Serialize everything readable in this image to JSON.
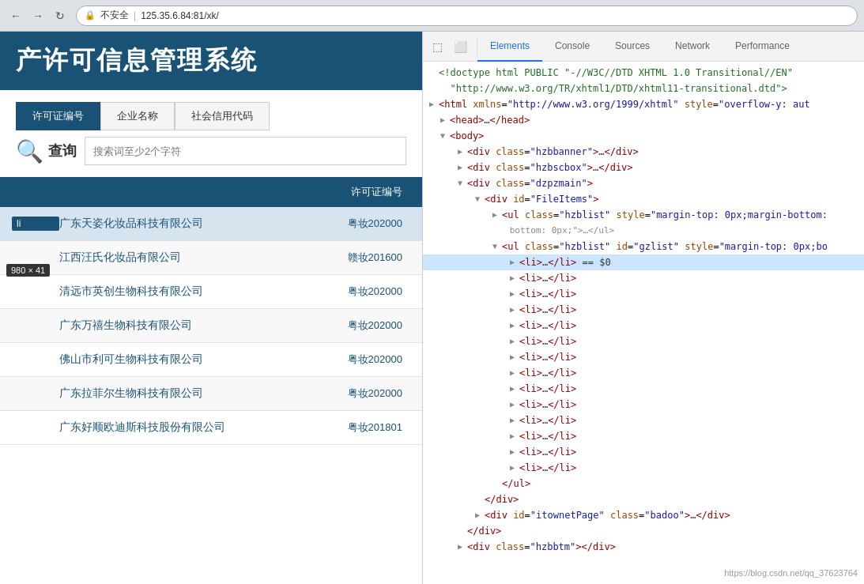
{
  "browser": {
    "back_label": "←",
    "forward_label": "→",
    "refresh_label": "↻",
    "address": "125.35.6.84:81/xk/",
    "lock_icon": "🔒",
    "insecure_label": "不安全"
  },
  "webpage": {
    "title": "产许可信息管理系统",
    "tabs": [
      {
        "label": "许可证编号",
        "active": true
      },
      {
        "label": "企业名称",
        "active": false
      },
      {
        "label": "社会信用代码",
        "active": false
      }
    ],
    "search_placeholder": "搜索词至少2个字符",
    "query_label": "查询",
    "table_header": {
      "col1": "",
      "col2": "许可证编号",
      "col3": ""
    },
    "tooltip": "980 × 41",
    "rows": [
      {
        "index": "li",
        "name": "广东天姿化妆品科技有限公司",
        "license": "粤妆202000",
        "highlighted": true
      },
      {
        "index": "",
        "name": "江西汪氏化妆品有限公司",
        "license": "赣妆201600",
        "highlighted": false
      },
      {
        "index": "",
        "name": "清远市英创生物科技有限公司",
        "license": "粤妆202000",
        "highlighted": false
      },
      {
        "index": "",
        "name": "广东万禧生物科技有限公司",
        "license": "粤妆202000",
        "highlighted": false
      },
      {
        "index": "",
        "name": "佛山市利可生物科技有限公司",
        "license": "粤妆202000",
        "highlighted": false
      },
      {
        "index": "",
        "name": "广东拉菲尔生物科技有限公司",
        "license": "粤妆202000",
        "highlighted": false
      },
      {
        "index": "",
        "name": "广东好顺欧迪斯科技股份有限公司",
        "license": "粤妆201801",
        "highlighted": false
      }
    ]
  },
  "devtools": {
    "tabs": [
      {
        "label": "Elements",
        "active": true
      },
      {
        "label": "Console",
        "active": false
      },
      {
        "label": "Sources",
        "active": false
      },
      {
        "label": "Network",
        "active": false
      },
      {
        "label": "Performance",
        "active": false
      }
    ],
    "code_lines": [
      {
        "indent": 0,
        "arrow": "none",
        "content": "<!doctype html PUBLIC \"-//W3C//DTD XHTML 1.0 Transitional//EN\"",
        "type": "comment"
      },
      {
        "indent": 0,
        "arrow": "none",
        "content": "  \"http://www.w3.org/TR/xhtml1/DTD/xhtml11-transitional.dtd\">",
        "type": "comment"
      },
      {
        "indent": 0,
        "arrow": "collapsed",
        "content": "<html xmlns=\"http://www.w3.org/1999/xhtml\" style=\"overflow-y: aut",
        "type": "tag"
      },
      {
        "indent": 1,
        "arrow": "collapsed",
        "content": "<head>…</head>",
        "type": "tag"
      },
      {
        "indent": 1,
        "arrow": "expanded",
        "content": "<body>",
        "type": "tag"
      },
      {
        "indent": 2,
        "arrow": "collapsed",
        "content": "<div class=\"hzbbanner\">…</div>",
        "type": "tag"
      },
      {
        "indent": 2,
        "arrow": "collapsed",
        "content": "<div class=\"hzbscbox\">…</div>",
        "type": "tag"
      },
      {
        "indent": 2,
        "arrow": "expanded",
        "content": "<div class=\"dzpzmain\">",
        "type": "tag"
      },
      {
        "indent": 3,
        "arrow": "expanded",
        "content": "<div id=\"FileItems\">",
        "type": "tag"
      },
      {
        "indent": 4,
        "arrow": "collapsed",
        "content": "<ul class=\"hzblist\" style=\"margin-top: 0px;margin-bottom:",
        "type": "tag"
      },
      {
        "indent": 4,
        "arrow": "expanded",
        "content": "▼ <ul class=\"hzblist\" id=\"gzlist\" style=\"margin-top: 0px;bo",
        "type": "tag-expanded"
      },
      {
        "indent": 5,
        "arrow": "none",
        "content": "<li>…</li> == $0",
        "type": "selected"
      },
      {
        "indent": 5,
        "arrow": "collapsed",
        "content": "<li>…</li>",
        "type": "tag"
      },
      {
        "indent": 5,
        "arrow": "collapsed",
        "content": "<li>…</li>",
        "type": "tag"
      },
      {
        "indent": 5,
        "arrow": "collapsed",
        "content": "<li>…</li>",
        "type": "tag"
      },
      {
        "indent": 5,
        "arrow": "collapsed",
        "content": "<li>…</li>",
        "type": "tag"
      },
      {
        "indent": 5,
        "arrow": "collapsed",
        "content": "<li>…</li>",
        "type": "tag"
      },
      {
        "indent": 5,
        "arrow": "collapsed",
        "content": "<li>…</li>",
        "type": "tag"
      },
      {
        "indent": 5,
        "arrow": "collapsed",
        "content": "<li>…</li>",
        "type": "tag"
      },
      {
        "indent": 5,
        "arrow": "collapsed",
        "content": "<li>…</li>",
        "type": "tag"
      },
      {
        "indent": 5,
        "arrow": "collapsed",
        "content": "<li>…</li>",
        "type": "tag"
      },
      {
        "indent": 5,
        "arrow": "collapsed",
        "content": "<li>…</li>",
        "type": "tag"
      },
      {
        "indent": 5,
        "arrow": "collapsed",
        "content": "<li>…</li>",
        "type": "tag"
      },
      {
        "indent": 5,
        "arrow": "collapsed",
        "content": "<li>…</li>",
        "type": "tag"
      },
      {
        "indent": 5,
        "arrow": "collapsed",
        "content": "<li>…</li>",
        "type": "tag"
      },
      {
        "indent": 4,
        "arrow": "none",
        "content": "</ul>",
        "type": "tag"
      },
      {
        "indent": 3,
        "arrow": "none",
        "content": "</div>",
        "type": "tag"
      },
      {
        "indent": 3,
        "arrow": "collapsed",
        "content": "<div id=\"itownetPage\" class=\"badoo\">…</div>",
        "type": "tag"
      },
      {
        "indent": 2,
        "arrow": "none",
        "content": "</div>",
        "type": "tag"
      },
      {
        "indent": 2,
        "arrow": "collapsed",
        "content": "<div class=\"hzbbtm\"></div>",
        "type": "tag"
      }
    ],
    "watermark": "https://blog.csdn.net/qq_37623764"
  }
}
